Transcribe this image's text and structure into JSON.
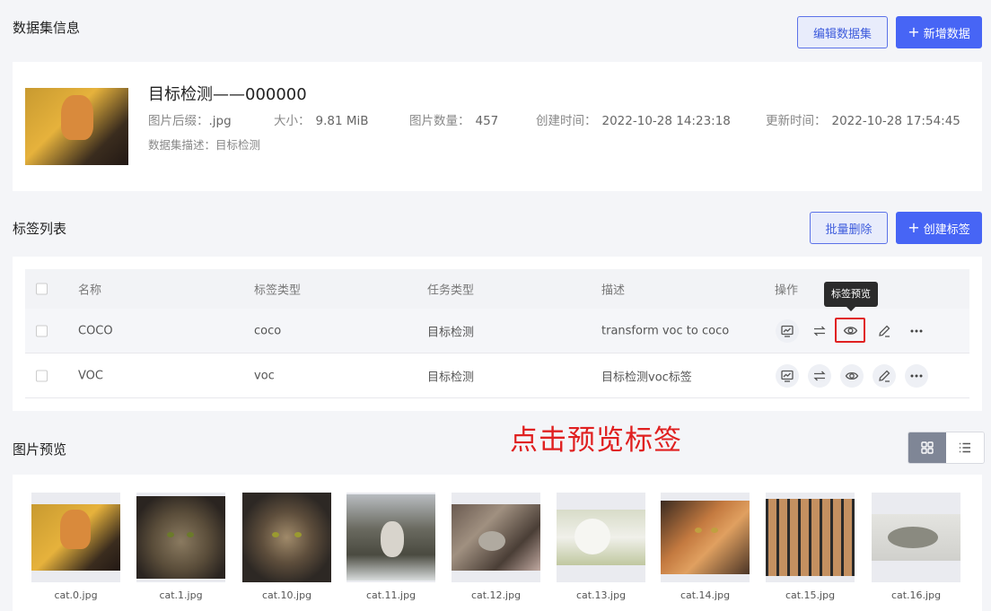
{
  "dataset_section": {
    "title": "数据集信息",
    "edit_button": "编辑数据集",
    "add_button": "新增数据"
  },
  "dataset": {
    "name": "目标检测——000000",
    "suffix_label": "图片后缀：",
    "suffix": ".jpg",
    "size_label": "大小：",
    "size": "9.81 MiB",
    "count_label": "图片数量：",
    "count": "457",
    "created_label": "创建时间：",
    "created": "2022-10-28 14:23:18",
    "updated_label": "更新时间：",
    "updated": "2022-10-28 17:54:45",
    "desc_label": "数据集描述：",
    "desc": "目标检测"
  },
  "label_section": {
    "title": "标签列表",
    "batch_delete_button": "批量删除",
    "create_button": "创建标签"
  },
  "table": {
    "columns": [
      "名称",
      "标签类型",
      "任务类型",
      "描述",
      "操作"
    ],
    "rows": [
      {
        "name": "COCO",
        "label_type": "coco",
        "task_type": "目标检测",
        "desc": "transform voc to coco"
      },
      {
        "name": "VOC",
        "label_type": "voc",
        "task_type": "目标检测",
        "desc": "目标检测voc标签"
      }
    ],
    "tooltip": "标签预览"
  },
  "annotation": "点击预览标签",
  "preview_section": {
    "title": "图片预览",
    "images": [
      {
        "name": "cat.0.jpg"
      },
      {
        "name": "cat.1.jpg"
      },
      {
        "name": "cat.10.jpg"
      },
      {
        "name": "cat.11.jpg"
      },
      {
        "name": "cat.12.jpg"
      },
      {
        "name": "cat.13.jpg"
      },
      {
        "name": "cat.14.jpg"
      },
      {
        "name": "cat.15.jpg"
      },
      {
        "name": "cat.16.jpg"
      }
    ]
  },
  "colors": {
    "primary": "#4765f5",
    "annotation": "#e02020",
    "page_bg": "#f4f5f8"
  },
  "icons": {
    "row_actions": [
      "chart-icon",
      "swap-icon",
      "eye-icon",
      "edit-icon",
      "more-icon"
    ],
    "view_toggle": [
      "grid-icon",
      "list-icon"
    ]
  }
}
